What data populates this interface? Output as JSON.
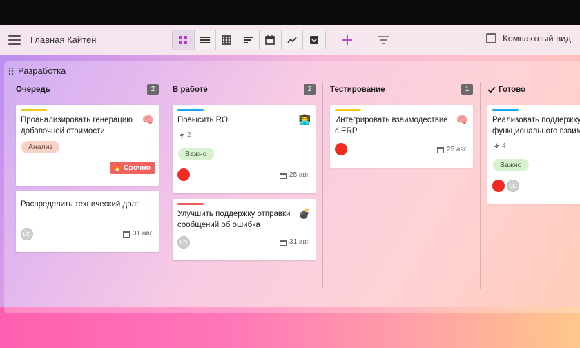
{
  "header": {
    "board_title": "Главная Кайтен",
    "views": [
      {
        "icon": "board-view-icon"
      },
      {
        "icon": "list-view-icon"
      },
      {
        "icon": "table-view-icon"
      },
      {
        "icon": "timeline-view-icon"
      },
      {
        "icon": "calendar-view-icon"
      },
      {
        "icon": "chart-view-icon"
      },
      {
        "icon": "archive-view-icon"
      }
    ],
    "compact_label": "Компактный вид",
    "compact_checked": false
  },
  "section": {
    "title": "Разработка"
  },
  "columns": [
    {
      "title": "Очередь",
      "count": "2",
      "cards": [
        {
          "title": "Проанализировать генерацию добавочной стоимости",
          "bar_color": "#f5c518",
          "emoji": "🧠",
          "tag": "Анализ",
          "urgent": "Срочно"
        },
        {
          "title": "Распределить технический долг",
          "avatar": "LD",
          "due": "31 авг."
        }
      ]
    },
    {
      "title": "В работе",
      "count": "2",
      "cards": [
        {
          "title": "Повысить ROI",
          "bar_color": "#1aa7e8",
          "emoji": "👨‍💻",
          "flash": "2",
          "tag": "Важно",
          "due": "25 авг."
        },
        {
          "title": "Улучшить поддержку отправки сообщений об ошибка",
          "bar_color": "#ec5a5a",
          "emoji": "💣",
          "avatar": "LD",
          "due": "31 авг."
        }
      ]
    },
    {
      "title": "Тестирование",
      "count": "1",
      "cards": [
        {
          "title": "Интегрировать взаимодествие с ERP",
          "bar_color": "#f5c518",
          "emoji": "🧠",
          "due": "25 авг."
        }
      ]
    },
    {
      "title": "Готово",
      "cards": [
        {
          "title": "Реализовать поддержку функционального взаим",
          "bar_color": "#1aa7e8",
          "flash": "4",
          "tag": "Важно",
          "avatar": "LD"
        }
      ]
    }
  ],
  "colors": {
    "accent": "#b03cc8",
    "urgent": "#f0625e",
    "avatar_red": "#f22b22"
  }
}
